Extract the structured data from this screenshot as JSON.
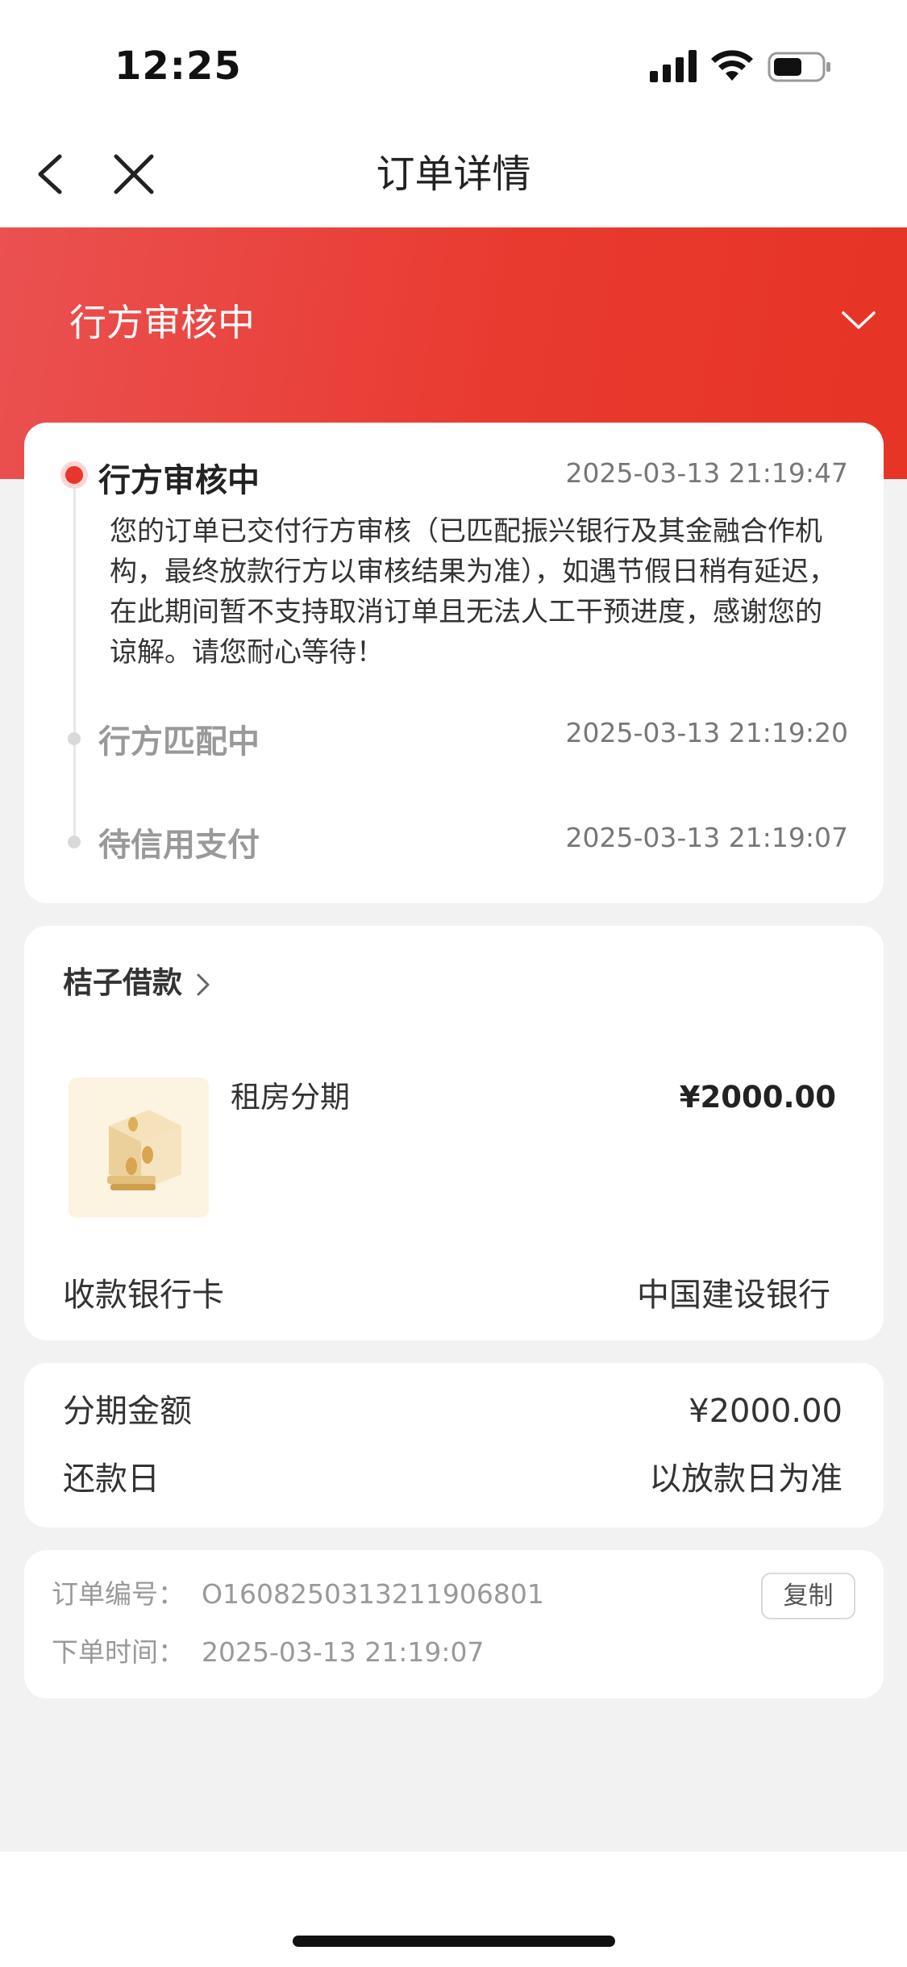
{
  "status_bar": {
    "time": "12:25"
  },
  "nav": {
    "title": "订单详情"
  },
  "header": {
    "status_title": "行方审核中"
  },
  "timeline": [
    {
      "title": "行方审核中",
      "time": "2025-03-13 21:19:47",
      "description": "您的订单已交付行方审核（已匹配振兴银行及其金融合作机构，最终放款行方以审核结果为准），如遇节假日稍有延迟，在此期间暂不支持取消订单且无法人工干预进度，感谢您的谅解。请您耐心等待！"
    },
    {
      "title": "行方匹配中",
      "time": "2025-03-13 21:19:20"
    },
    {
      "title": "待信用支付",
      "time": "2025-03-13 21:19:07"
    }
  ],
  "merchant": {
    "name": "桔子借款",
    "product_name": "租房分期",
    "product_price": "¥2000.00",
    "bank_label": "收款银行卡",
    "bank_value": "中国建设银行"
  },
  "installment": {
    "amount_label": "分期金额",
    "amount_value": "¥2000.00",
    "repay_label": "还款日",
    "repay_value": "以放款日为准"
  },
  "order": {
    "number_label": "订单编号：",
    "number_value": "O1608250313211906801",
    "time_label": "下单时间：",
    "time_value": "2025-03-13 21:19:07",
    "copy_label": "复制"
  },
  "colors": {
    "accent_red": "#e9352b",
    "header_gradient_start": "#ea5151",
    "header_gradient_end": "#e63425",
    "background": "#f2f2f2"
  }
}
